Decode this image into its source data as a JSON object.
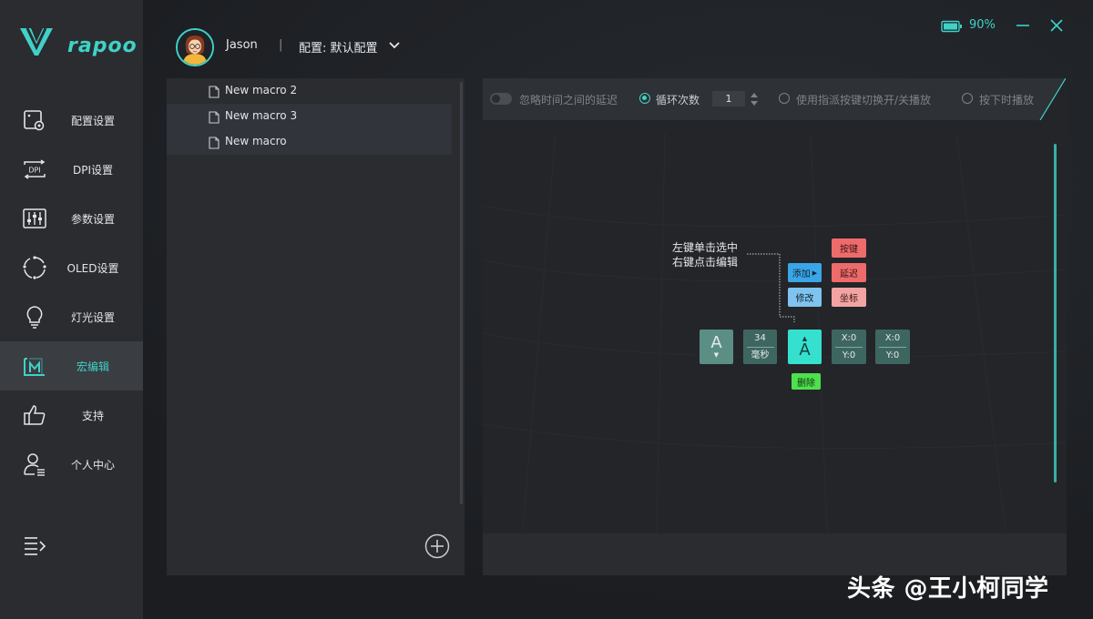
{
  "app": {
    "brand": "rapoo"
  },
  "sidebar": {
    "items": [
      {
        "label": "配置设置",
        "icon": "profile-settings-icon"
      },
      {
        "label": "DPI设置",
        "icon": "dpi-icon"
      },
      {
        "label": "参数设置",
        "icon": "sliders-icon"
      },
      {
        "label": "OLED设置",
        "icon": "oled-icon"
      },
      {
        "label": "灯光设置",
        "icon": "lightbulb-icon"
      },
      {
        "label": "宏编辑",
        "icon": "macro-icon",
        "active": true
      },
      {
        "label": "支持",
        "icon": "thumbs-up-icon"
      },
      {
        "label": "个人中心",
        "icon": "user-center-icon"
      }
    ]
  },
  "header": {
    "user_name": "Jason",
    "separator": "|",
    "profile_label": "配置: 默认配置",
    "battery": "90%"
  },
  "macros": {
    "items": [
      "New macro 2",
      "New macro 3",
      "New macro"
    ]
  },
  "toolbar": {
    "ignore_delay_label": "忽略时间之间的延迟",
    "loop_label": "循环次数",
    "loop_value": "1",
    "toggle_key_label": "使用指派按键切换开/关播放",
    "hold_play_label": "按下时播放"
  },
  "diagram": {
    "hint_line1": "左键单击选中",
    "hint_line2": "右键点击编辑",
    "add_label": "添加",
    "modify_label": "修改",
    "key_label": "按键",
    "delay_label": "延迟",
    "coord_label": "坐标",
    "delete_label": "删除",
    "key1_letter": "A",
    "delay_value": "34",
    "delay_unit": "毫秒",
    "key2_letter": "A",
    "coord1_x": "X:0",
    "coord1_y": "Y:0",
    "coord2_x": "X:0",
    "coord2_y": "Y:0"
  },
  "watermark": "头条 @王小柯同学",
  "colors": {
    "accent": "#3fd2c7",
    "add_blue": "#3aa6e8",
    "modify_blue": "#7fc3ee",
    "red": "#ee6b6b",
    "pink": "#f2a3a3",
    "delete_green": "#4ee04e",
    "key_teal": "#5b8f86",
    "active_key": "#35e0cf"
  }
}
